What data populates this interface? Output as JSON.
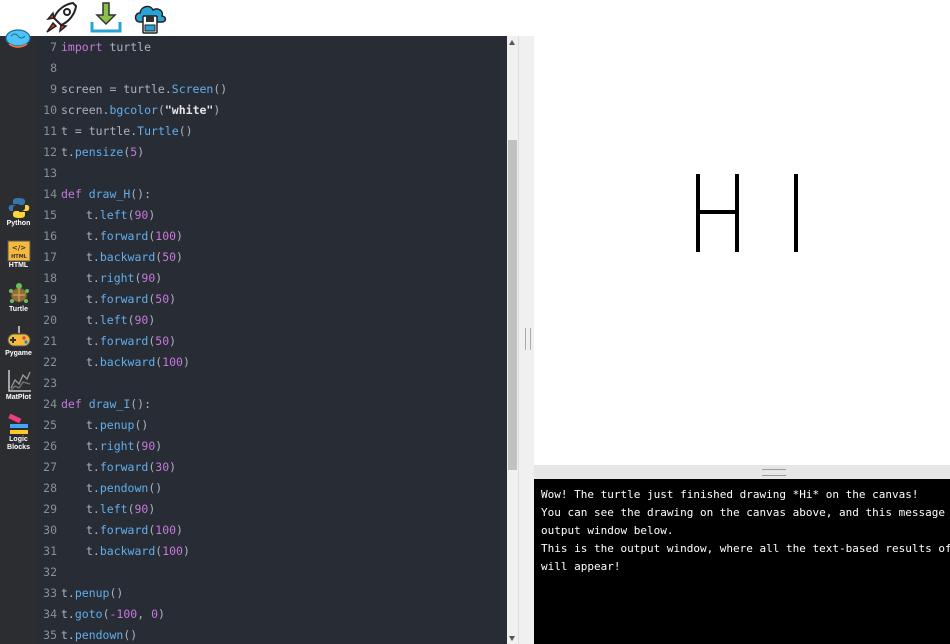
{
  "toolbar": {
    "run_icon": "rocket-icon",
    "download_icon": "download-icon",
    "save_icon": "cloud-save-icon"
  },
  "sidebar": {
    "logo_icon": "brain-logo-icon",
    "items": [
      {
        "label": "Python",
        "icon": "python-icon"
      },
      {
        "label": "HTML",
        "icon": "html-icon"
      },
      {
        "label": "Turtle",
        "icon": "turtle-icon"
      },
      {
        "label": "Pygame",
        "icon": "gamepad-icon"
      },
      {
        "label": "MatPlot",
        "icon": "chart-icon"
      },
      {
        "label": "Logic",
        "label2": "Blocks",
        "icon": "logic-blocks-icon"
      }
    ]
  },
  "editor": {
    "lines": [
      {
        "n": "7",
        "code": "import turtle"
      },
      {
        "n": "8",
        "code": ""
      },
      {
        "n": "9",
        "code": "screen = turtle.Screen()"
      },
      {
        "n": "10",
        "code": "screen.bgcolor(\"white\")"
      },
      {
        "n": "11",
        "code": "t = turtle.Turtle()"
      },
      {
        "n": "12",
        "code": "t.pensize(5)"
      },
      {
        "n": "13",
        "code": ""
      },
      {
        "n": "14",
        "code": "def draw_H():"
      },
      {
        "n": "15",
        "code": "    t.left(90)"
      },
      {
        "n": "16",
        "code": "    t.forward(100)"
      },
      {
        "n": "17",
        "code": "    t.backward(50)"
      },
      {
        "n": "18",
        "code": "    t.right(90)"
      },
      {
        "n": "19",
        "code": "    t.forward(50)"
      },
      {
        "n": "20",
        "code": "    t.left(90)"
      },
      {
        "n": "21",
        "code": "    t.forward(50)"
      },
      {
        "n": "22",
        "code": "    t.backward(100)"
      },
      {
        "n": "23",
        "code": ""
      },
      {
        "n": "24",
        "code": "def draw_I():"
      },
      {
        "n": "25",
        "code": "    t.penup()"
      },
      {
        "n": "26",
        "code": "    t.right(90)"
      },
      {
        "n": "27",
        "code": "    t.forward(30)"
      },
      {
        "n": "28",
        "code": "    t.pendown()"
      },
      {
        "n": "29",
        "code": "    t.left(90)"
      },
      {
        "n": "30",
        "code": "    t.forward(100)"
      },
      {
        "n": "31",
        "code": "    t.backward(100)"
      },
      {
        "n": "32",
        "code": ""
      },
      {
        "n": "33",
        "code": "t.penup()"
      },
      {
        "n": "34",
        "code": "t.goto(-100, 0)"
      },
      {
        "n": "35",
        "code": "t.pendown()"
      }
    ]
  },
  "output": {
    "lines": [
      "Wow! The turtle just finished drawing *Hi* on the canvas!",
      "You can see the drawing on the canvas above, and this message in t",
      "output window below.",
      "This is the output window, where all the text-based results of you",
      "will appear!"
    ]
  },
  "colors": {
    "editor_bg": "#282c34",
    "sidebar_bg": "#2b2d31",
    "keyword": "#c678dd",
    "function": "#61afef",
    "output_bg": "#000000"
  }
}
